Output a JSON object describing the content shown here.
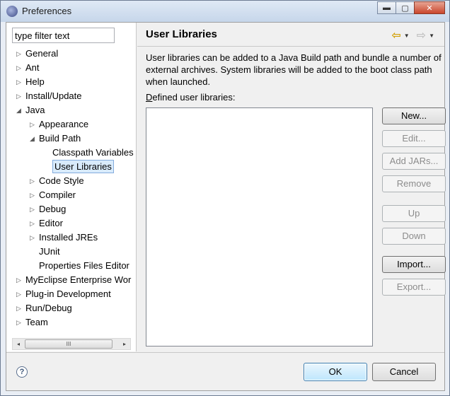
{
  "window": {
    "title": "Preferences",
    "minimize": "▬",
    "maximize": "▢",
    "close": "✕"
  },
  "filter": {
    "value": "type filter text"
  },
  "tree": [
    {
      "label": "General",
      "toggle": "▷"
    },
    {
      "label": "Ant",
      "toggle": "▷"
    },
    {
      "label": "Help",
      "toggle": "▷"
    },
    {
      "label": "Install/Update",
      "toggle": "▷"
    },
    {
      "label": "Java",
      "toggle": "◢"
    },
    {
      "label": "Appearance",
      "toggle": "▷"
    },
    {
      "label": "Build Path",
      "toggle": "◢"
    },
    {
      "label": "Classpath Variables",
      "toggle": ""
    },
    {
      "label": "User Libraries",
      "toggle": ""
    },
    {
      "label": "Code Style",
      "toggle": "▷"
    },
    {
      "label": "Compiler",
      "toggle": "▷"
    },
    {
      "label": "Debug",
      "toggle": "▷"
    },
    {
      "label": "Editor",
      "toggle": "▷"
    },
    {
      "label": "Installed JREs",
      "toggle": "▷"
    },
    {
      "label": "JUnit",
      "toggle": ""
    },
    {
      "label": "Properties Files Editor",
      "toggle": ""
    },
    {
      "label": "MyEclipse Enterprise Wor",
      "toggle": "▷"
    },
    {
      "label": "Plug-in Development",
      "toggle": "▷"
    },
    {
      "label": "Run/Debug",
      "toggle": "▷"
    },
    {
      "label": "Team",
      "toggle": "▷"
    }
  ],
  "scroll": {
    "thumb": "III",
    "left": "◂",
    "right": "▸"
  },
  "page": {
    "title": "User Libraries",
    "description": "User libraries can be added to a Java Build path and bundle a number of external archives. System libraries will be added to the boot class path when launched.",
    "defined_label_first": "D",
    "defined_label_rest": "efined user libraries:"
  },
  "nav": {
    "back": "⇦",
    "dropdown": "▼",
    "forward": "⇨"
  },
  "buttons": {
    "new": "New...",
    "edit": "Edit...",
    "add_jars": "Add JARs...",
    "remove": "Remove",
    "up": "Up",
    "down": "Down",
    "import": "Import...",
    "export": "Export..."
  },
  "footer": {
    "help": "?",
    "ok": "OK",
    "cancel": "Cancel"
  }
}
